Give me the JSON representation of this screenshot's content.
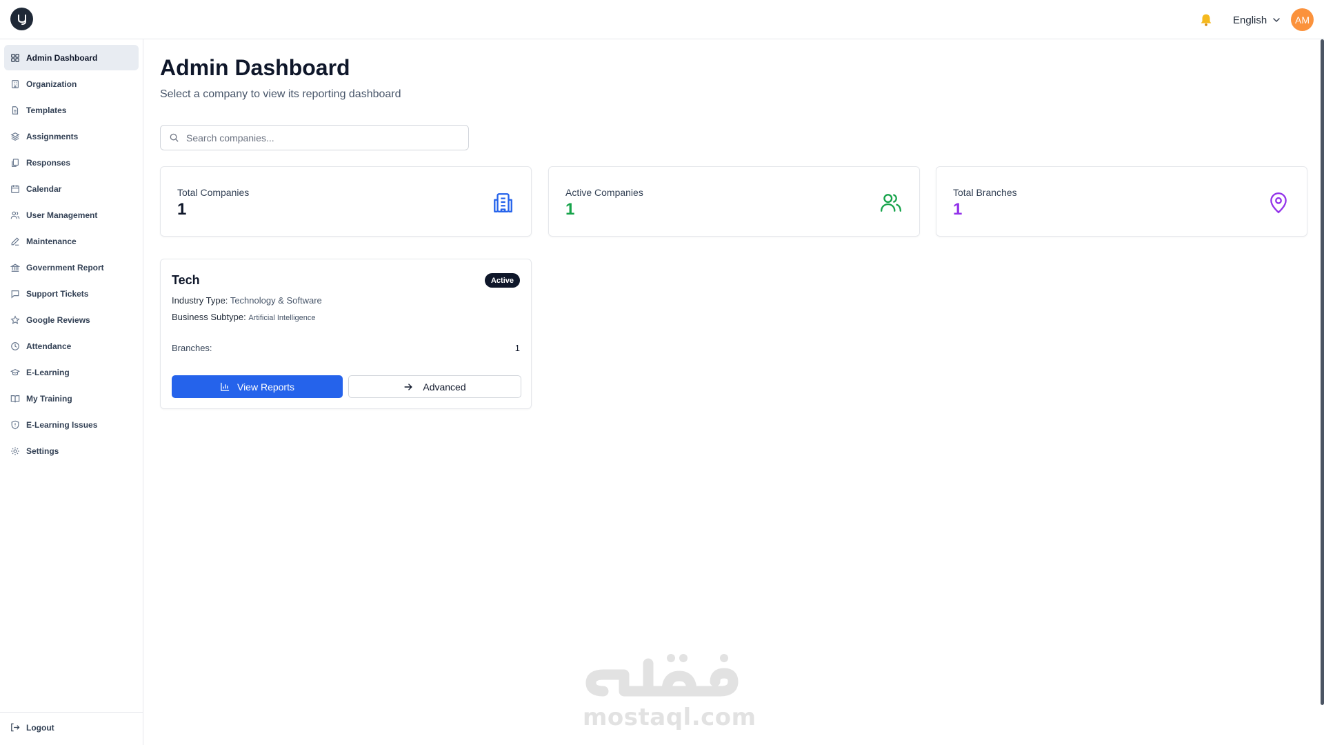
{
  "header": {
    "logo_letter": "y",
    "language": "English",
    "avatar_initials": "AM"
  },
  "sidebar": {
    "items": [
      {
        "label": "Admin Dashboard",
        "icon": "grid-icon"
      },
      {
        "label": "Organization",
        "icon": "building-icon"
      },
      {
        "label": "Templates",
        "icon": "file-text-icon"
      },
      {
        "label": "Assignments",
        "icon": "layers-icon"
      },
      {
        "label": "Responses",
        "icon": "files-icon"
      },
      {
        "label": "Calendar",
        "icon": "calendar-icon"
      },
      {
        "label": "User Management",
        "icon": "users-icon"
      },
      {
        "label": "Maintenance",
        "icon": "pen-icon"
      },
      {
        "label": "Government Report",
        "icon": "landmark-icon"
      },
      {
        "label": "Support Tickets",
        "icon": "message-icon"
      },
      {
        "label": "Google Reviews",
        "icon": "star-icon"
      },
      {
        "label": "Attendance",
        "icon": "clock-icon"
      },
      {
        "label": "E-Learning",
        "icon": "graduation-cap-icon"
      },
      {
        "label": "My Training",
        "icon": "book-open-icon"
      },
      {
        "label": "E-Learning Issues",
        "icon": "shield-alert-icon"
      },
      {
        "label": "Settings",
        "icon": "gear-icon"
      }
    ],
    "active_index": 0,
    "logout_label": "Logout"
  },
  "main": {
    "title": "Admin Dashboard",
    "subtitle": "Select a company to view its reporting dashboard",
    "search": {
      "placeholder": "Search companies...",
      "value": ""
    },
    "stats": [
      {
        "label": "Total Companies",
        "value": "1",
        "color": "#0f172a",
        "icon": "building-icon",
        "icon_color": "#2563eb"
      },
      {
        "label": "Active Companies",
        "value": "1",
        "color": "#16a34a",
        "icon": "users-icon",
        "icon_color": "#16a34a"
      },
      {
        "label": "Total Branches",
        "value": "1",
        "color": "#9333ea",
        "icon": "map-pin-icon",
        "icon_color": "#9333ea"
      }
    ],
    "company": {
      "name": "Tech",
      "status": "Active",
      "industry_label": "Industry Type:",
      "industry_value": "Technology & Software",
      "subtype_label": "Business Subtype:",
      "subtype_value": "Artificial Intelligence",
      "branches_label": "Branches:",
      "branches_value": "1",
      "view_reports_label": "View Reports",
      "advanced_label": "Advanced"
    }
  },
  "watermark": {
    "arabic": "مستقل",
    "text": "mostaql.com"
  },
  "colors": {
    "accent": "#2563eb",
    "sidebar_active_bg": "#e8ecf2",
    "avatar_bg": "#fb923c",
    "badge_bg": "#0f172a"
  }
}
